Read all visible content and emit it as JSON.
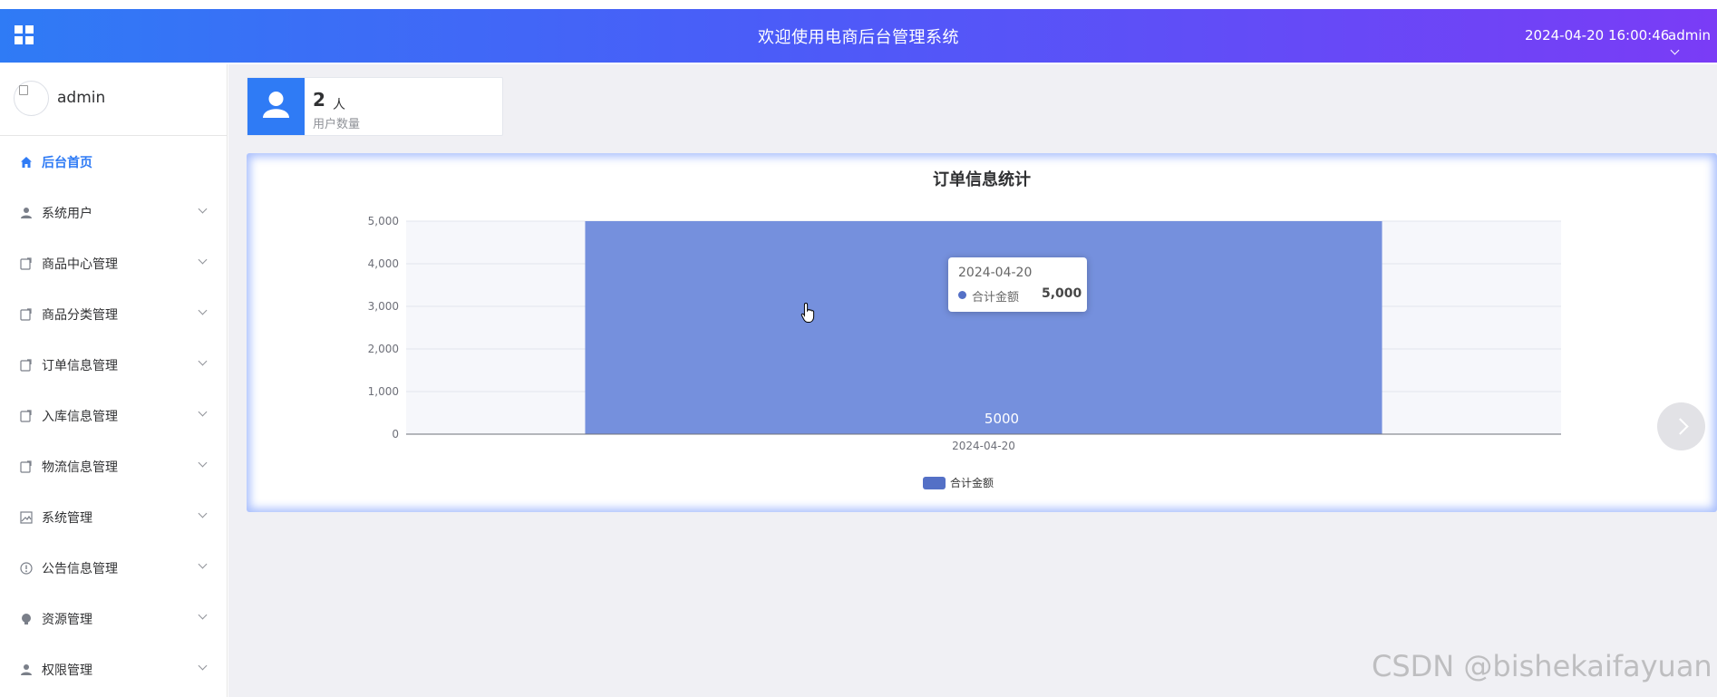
{
  "header": {
    "title": "欢迎使用电商后台管理系统",
    "datetime": "2024-04-20 16:00:46",
    "user": "admin"
  },
  "sidebar": {
    "username": "admin",
    "items": [
      {
        "label": "后台首页",
        "icon": "home-icon",
        "active": true
      },
      {
        "label": "系统用户",
        "icon": "user-icon"
      },
      {
        "label": "商品中心管理",
        "icon": "document-icon"
      },
      {
        "label": "商品分类管理",
        "icon": "document-icon"
      },
      {
        "label": "订单信息管理",
        "icon": "document-icon"
      },
      {
        "label": "入库信息管理",
        "icon": "document-icon"
      },
      {
        "label": "物流信息管理",
        "icon": "document-icon"
      },
      {
        "label": "系统管理",
        "icon": "image-icon"
      },
      {
        "label": "公告信息管理",
        "icon": "info-icon"
      },
      {
        "label": "资源管理",
        "icon": "bulb-icon"
      },
      {
        "label": "权限管理",
        "icon": "user-icon"
      }
    ]
  },
  "stat": {
    "value": "2",
    "unit": "人",
    "label": "用户数量"
  },
  "chart_data": {
    "type": "bar",
    "title": "订单信息统计",
    "categories": [
      "2024-04-20"
    ],
    "series": [
      {
        "name": "合计金额",
        "values": [
          5000
        ],
        "color": "#5470c6"
      }
    ],
    "ylim": [
      0,
      5000
    ],
    "yticks": [
      "0",
      "1,000",
      "2,000",
      "3,000",
      "4,000",
      "5,000"
    ],
    "data_labels": [
      "5000"
    ],
    "legend": "bottom-center",
    "grid": true
  },
  "tooltip": {
    "date": "2024-04-20",
    "name": "合计金额",
    "value": "5,000"
  },
  "watermark": "CSDN @bishekaifayuan"
}
